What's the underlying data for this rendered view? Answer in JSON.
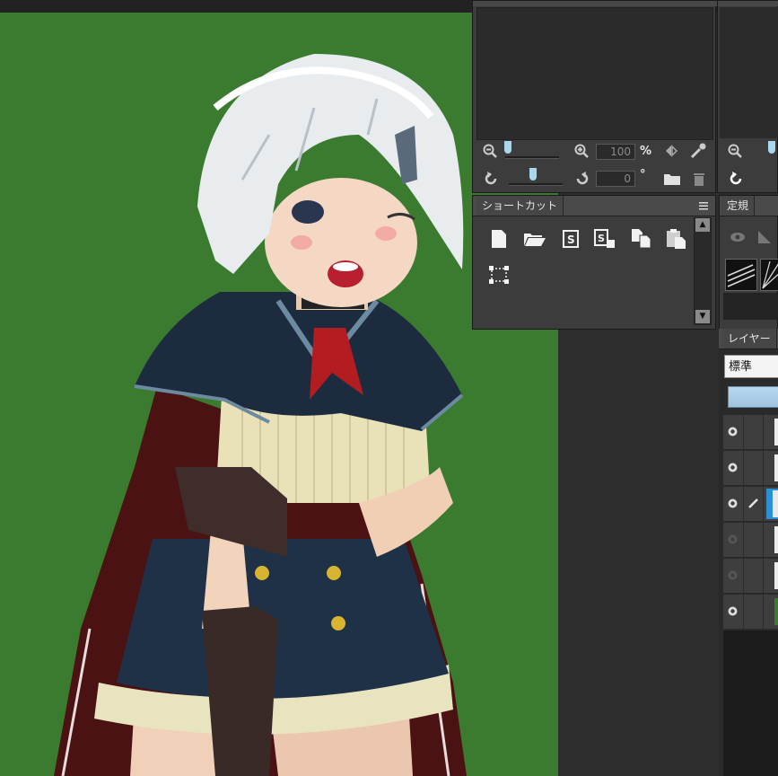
{
  "navigator": {
    "zoom_value": "100",
    "zoom_unit": "%",
    "rotate_value": "0",
    "rotate_unit": "°"
  },
  "shortcut_panel": {
    "title": "ショートカット",
    "menu_icon": "hamburger-icon",
    "tools": [
      "new-file-icon",
      "open-folder-icon",
      "save-s-icon",
      "save-as-s-icon",
      "copy-icon",
      "paste-icon",
      "select-dotted-icon"
    ]
  },
  "ruler_panel": {
    "title": "定規"
  },
  "layer_panel": {
    "title": "レイヤー",
    "blend_mode": "標準",
    "layers": [
      {
        "visible": true,
        "editing": false
      },
      {
        "visible": true,
        "editing": false
      },
      {
        "visible": true,
        "editing": true
      },
      {
        "visible": false,
        "editing": false
      },
      {
        "visible": false,
        "editing": false
      },
      {
        "visible": true,
        "editing": false
      }
    ]
  },
  "colors": {
    "canvas_bg": "#3b7b2f",
    "panel_bg": "#3c3c3c",
    "accent": "#2a8fd6"
  }
}
